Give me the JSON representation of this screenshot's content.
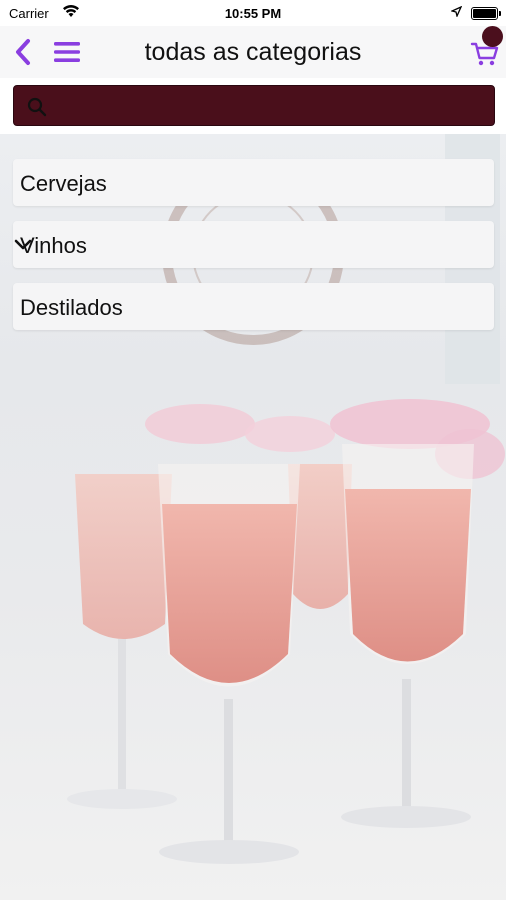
{
  "status_bar": {
    "carrier": "Carrier",
    "time": "10:55 PM"
  },
  "nav": {
    "title": "todas as categorias",
    "icons": [
      "chevron-left-icon",
      "menu-icon",
      "cart-icon"
    ],
    "accent_color": "#8a3ee0"
  },
  "search": {
    "placeholder": "",
    "value": "",
    "background_color": "#4a0f1b"
  },
  "categories": [
    {
      "label": "Cervejas",
      "expandable": false
    },
    {
      "label": "Vinhos",
      "expandable": true
    },
    {
      "label": "Destilados",
      "expandable": false
    }
  ]
}
